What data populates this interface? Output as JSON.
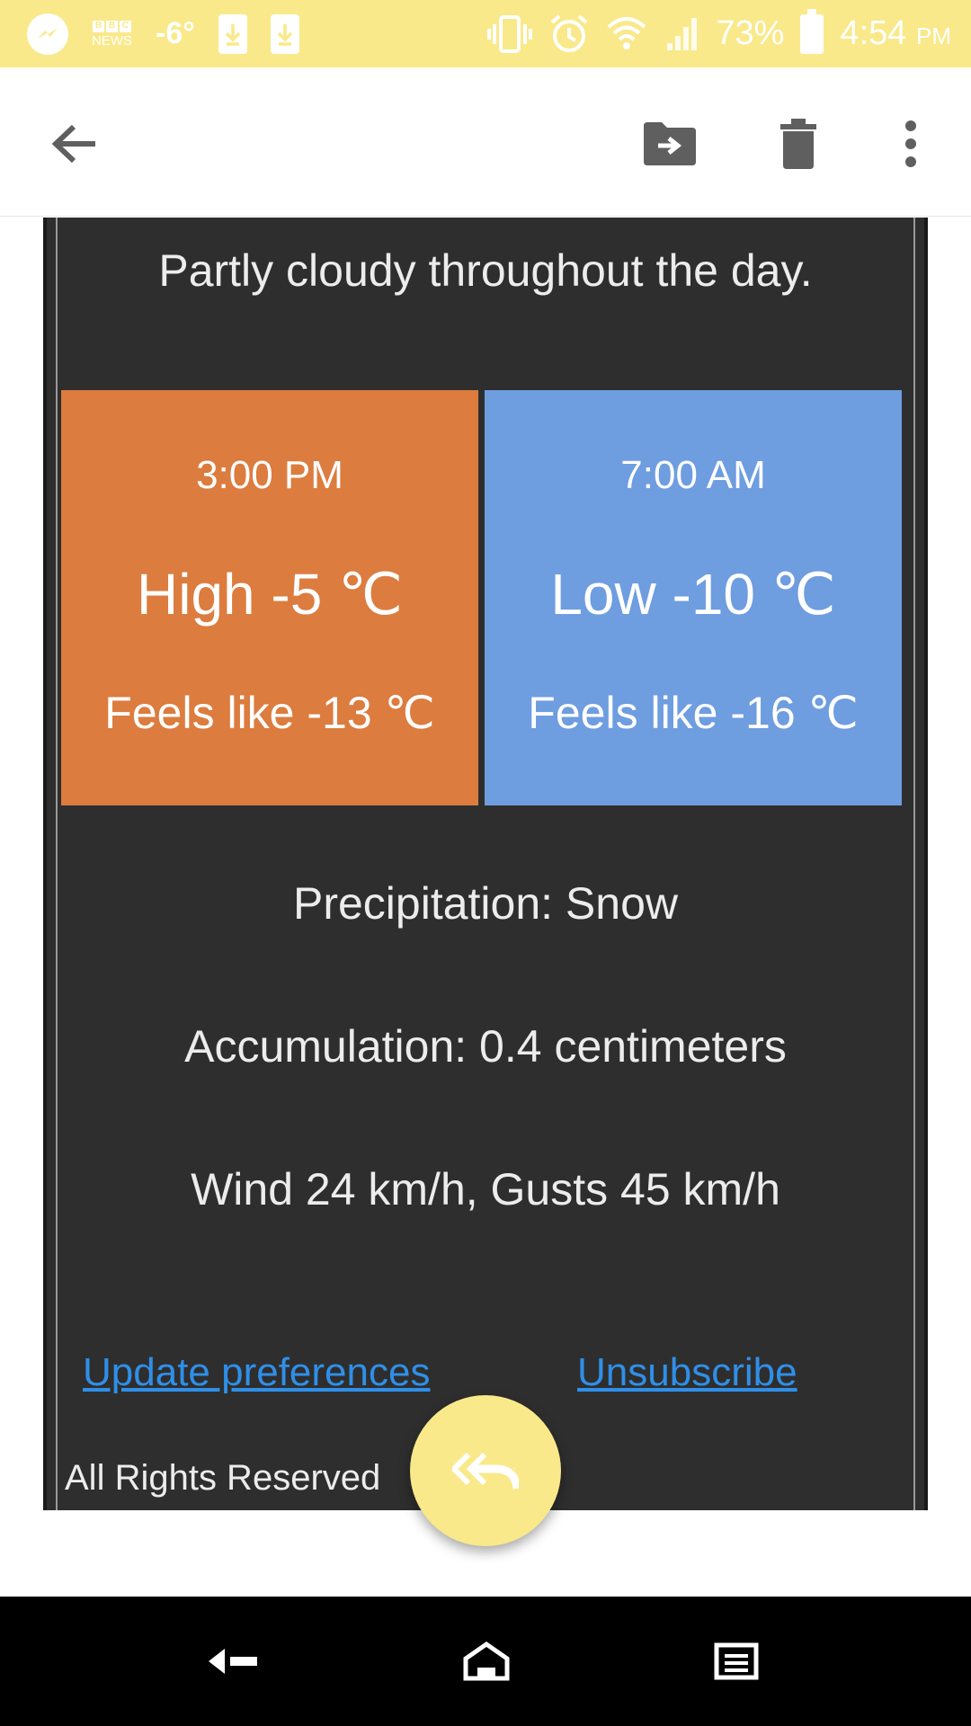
{
  "status_bar": {
    "temperature": "-6°",
    "battery_percent": "73%",
    "time": "4:54",
    "ampm": "PM",
    "bbc_top": "BBC",
    "bbc_bottom": "NEWS"
  },
  "app_bar": {
    "icons": [
      "back-arrow-icon",
      "move-to-folder-icon",
      "trash-icon",
      "more-vert-icon"
    ]
  },
  "email": {
    "summary": "Partly cloudy throughout the day.",
    "high_card": {
      "time": "3:00 PM",
      "label": "High -5 ℃",
      "feels_like": "Feels like -13 ℃",
      "color": "#dc7c3e"
    },
    "low_card": {
      "time": "7:00 AM",
      "label": "Low -10 ℃",
      "feels_like": "Feels like -16 ℃",
      "color": "#6e9de0"
    },
    "precipitation": "Precipitation: Snow",
    "accumulation": "Accumulation: 0.4 centimeters",
    "wind": "Wind 24 km/h, Gusts 45 km/h",
    "update_link": "Update preferences",
    "unsubscribe_link": "Unsubscribe",
    "footer": "All Rights Reserved"
  },
  "colors": {
    "status_bar": "#f9e98a",
    "email_bg": "#2e2e2e",
    "link": "#2f8fe8",
    "fab": "#f9e98a"
  }
}
